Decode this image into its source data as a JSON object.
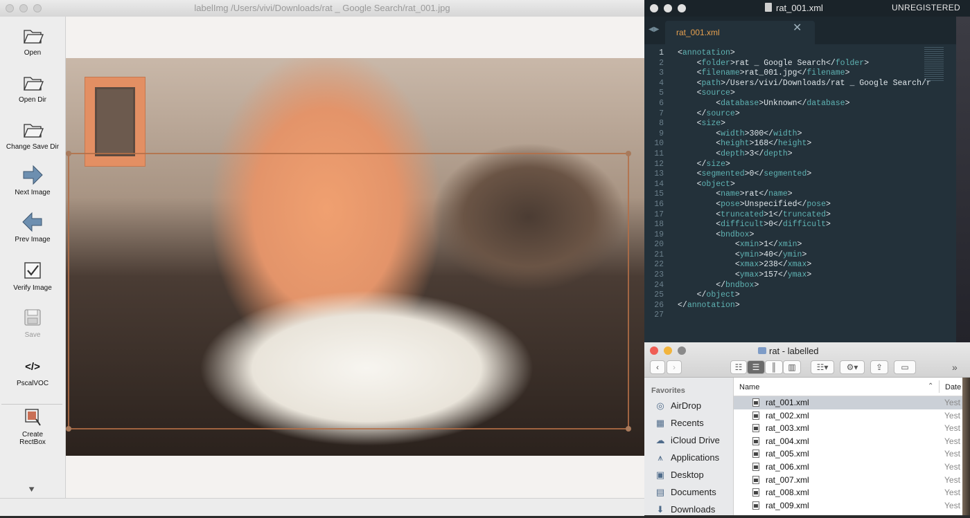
{
  "labelimg": {
    "title": "labelImg /Users/vivi/Downloads/rat _ Google Search/rat_001.jpg",
    "tools": [
      {
        "label": "Open",
        "icon": "folder-icon"
      },
      {
        "label": "Open Dir",
        "icon": "folder-icon"
      },
      {
        "label": "Change Save Dir",
        "icon": "folder-icon"
      },
      {
        "label": "Next Image",
        "icon": "arrow-right-icon"
      },
      {
        "label": "Prev Image",
        "icon": "arrow-left-icon"
      },
      {
        "label": "Verify Image",
        "icon": "checkbox-icon"
      },
      {
        "label": "Save",
        "icon": "floppy-disk-icon",
        "disabled": true
      },
      {
        "label": "PscalVOC",
        "icon": "code-icon"
      },
      {
        "label": "Create\nRectBox",
        "icon": "rectbox-icon"
      }
    ]
  },
  "editor": {
    "file_title": "rat_001.xml",
    "unregistered": "UNREGISTERED",
    "tab_label": "rat_001.xml",
    "line_numbers": [
      "1",
      "2",
      "3",
      "4",
      "5",
      "6",
      "7",
      "8",
      "9",
      "10",
      "11",
      "12",
      "13",
      "14",
      "15",
      "16",
      "17",
      "18",
      "19",
      "20",
      "21",
      "22",
      "23",
      "24",
      "25",
      "26",
      "27"
    ],
    "lines": [
      "<annotation>",
      "    <folder>rat _ Google Search</folder>",
      "    <filename>rat_001.jpg</filename>",
      "    <path>/Users/vivi/Downloads/rat _ Google Search/r",
      "    <source>",
      "        <database>Unknown</database>",
      "    </source>",
      "    <size>",
      "        <width>300</width>",
      "        <height>168</height>",
      "        <depth>3</depth>",
      "    </size>",
      "    <segmented>0</segmented>",
      "    <object>",
      "        <name>rat</name>",
      "        <pose>Unspecified</pose>",
      "        <truncated>1</truncated>",
      "        <difficult>0</difficult>",
      "        <bndbox>",
      "            <xmin>1</xmin>",
      "            <ymin>40</ymin>",
      "            <xmax>238</xmax>",
      "            <ymax>157</ymax>",
      "        </bndbox>",
      "    </object>",
      "</annotation>",
      ""
    ]
  },
  "finder": {
    "title": "rat - labelled",
    "favorites_label": "Favorites",
    "sidebar": [
      {
        "label": "AirDrop",
        "icon": "airdrop-icon"
      },
      {
        "label": "Recents",
        "icon": "recents-icon"
      },
      {
        "label": "iCloud Drive",
        "icon": "cloud-icon"
      },
      {
        "label": "Applications",
        "icon": "applications-icon"
      },
      {
        "label": "Desktop",
        "icon": "desktop-icon"
      },
      {
        "label": "Documents",
        "icon": "documents-icon"
      },
      {
        "label": "Downloads",
        "icon": "downloads-icon"
      }
    ],
    "col_name": "Name",
    "col_date": "Date",
    "files": [
      {
        "name": "rat_001.xml",
        "date": "Yest"
      },
      {
        "name": "rat_002.xml",
        "date": "Yest"
      },
      {
        "name": "rat_003.xml",
        "date": "Yest"
      },
      {
        "name": "rat_004.xml",
        "date": "Yest"
      },
      {
        "name": "rat_005.xml",
        "date": "Yest"
      },
      {
        "name": "rat_006.xml",
        "date": "Yest"
      },
      {
        "name": "rat_007.xml",
        "date": "Yest"
      },
      {
        "name": "rat_008.xml",
        "date": "Yest"
      },
      {
        "name": "rat_009.xml",
        "date": "Yest"
      }
    ],
    "selected_index": 0
  },
  "colors": {
    "editor_bg": "#23313a",
    "tag": "#5fb3b3",
    "tab_label": "#e6a04f",
    "finder_selection": "#cbd0d7"
  }
}
